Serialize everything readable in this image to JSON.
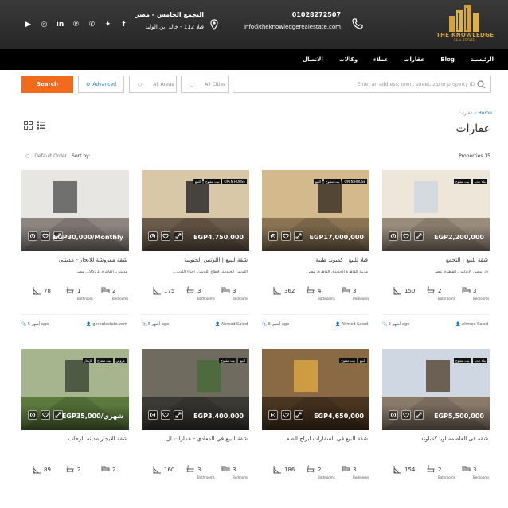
{
  "header": {
    "logo_text": "THE KNOWLEDGE",
    "logo_sub": "REAL ESTATE",
    "phone": "01028272507",
    "email": "info@theknowledgerealestate.com",
    "address_line1": "التجمع الخامس - مصر",
    "address_line2": "فيلا 112 - خالد ابن الوليد",
    "socials": [
      "facebook-icon",
      "twitter-icon",
      "whatsapp-icon",
      "pinterest-icon",
      "linkedin-icon",
      "instagram-icon",
      "youtube-icon"
    ]
  },
  "nav": {
    "items": [
      "الرئيسية",
      "Blog",
      "عقارات",
      "عملاء",
      "وكالات",
      "الاتصال"
    ]
  },
  "search": {
    "button": "Search",
    "advanced": "Advanced",
    "areas": "All Areas",
    "cities": "All Cities",
    "address_placeholder": "Enter an address, town, street, zip or property ID"
  },
  "breadcrumb": {
    "home": "Home",
    "current": "عقارات"
  },
  "page_title": "عقارات",
  "listing": {
    "count": "Properties 15",
    "sort_label": "Sort by:",
    "sort_value": "Default Order"
  },
  "cards": [
    {
      "tags": [],
      "price": "EGP30,000/Monthly",
      "title": "شقة مفروشة للايجار - مدينتي",
      "address": "مدينتي, القاهرة, 19511, مصر",
      "area": "78",
      "area_label": "",
      "baths": "1",
      "baths_label": "Bathroom",
      "beds": "2",
      "beds_label": "Bedrooms",
      "agent": "gerealestate.com",
      "time": "5 أشهر ago"
    },
    {
      "tags": [
        "للبيع",
        "بيت مفتوح",
        "OPEN HOUSE"
      ],
      "price": "EGP4,750,000",
      "title": "شقة للبيع | اللوتس الجنوبية",
      "address": "اللوتس الجنوبية, قطاع اللوتس, أحياء اللوت...",
      "area": "175",
      "area_label": "",
      "baths": "3",
      "baths_label": "Bathrooms",
      "beds": "3",
      "beds_label": "Bedrooms",
      "agent": "Ahmed Saied",
      "time": "5 أشهر ago"
    },
    {
      "tags": [
        "للبيع",
        "بيت مفتوح",
        "OPEN HOUSE"
      ],
      "price": "EGP17,000,000",
      "title": "فيلا للبيع | كمبوند طيبة",
      "address": "مدينة القاهرة الجديدة, القاهرة, مصر",
      "area": "362",
      "area_label": "",
      "baths": "4",
      "baths_label": "Bathrooms",
      "beds": "3",
      "beds_label": "Bedrooms",
      "agent": "Ahmed Saied",
      "time": "5 أشهر ago"
    },
    {
      "tags": [
        "بيت مفتوح",
        "بناء جديد"
      ],
      "price": "EGP2,200,000",
      "title": "شقة للبيع | التجمع",
      "address": "دار مصر, الأندلس, القاهرة, مصر",
      "area": "150",
      "area_label": "",
      "baths": "2",
      "baths_label": "Bathrooms",
      "beds": "3",
      "beds_label": "Bedrooms",
      "agent": "Ahmed Saied",
      "time": "5 أشهر ago"
    },
    {
      "tags": [
        "للإيجار",
        "بيت مفتوح",
        "عروض"
      ],
      "price": "EGP35,000/شهري",
      "title": "شقة للايجار مدينه الرحاب",
      "address": "",
      "area": "89",
      "area_label": "",
      "baths": "2",
      "baths_label": "",
      "beds": "2",
      "beds_label": "",
      "agent": "",
      "time": ""
    },
    {
      "tags": [
        "بيت مفتوح",
        "للبيع"
      ],
      "price": "EGP3,400,000",
      "title": "شقة للبيع في المعادي - عمارات ال...",
      "address": "",
      "area": "160",
      "area_label": "",
      "baths": "3",
      "baths_label": "Bathrooms",
      "beds": "3",
      "beds_label": "Bedrooms",
      "agent": "",
      "time": ""
    },
    {
      "tags": [
        "بيت مفتوح",
        "للبيع"
      ],
      "price": "EGP4,650,000",
      "title": "شقة للبيع في السفارات ابراج الصفـ...",
      "address": "",
      "area": "186",
      "area_label": "",
      "baths": "2",
      "baths_label": "Bathrooms",
      "beds": "3",
      "beds_label": "Bedrooms",
      "agent": "",
      "time": ""
    },
    {
      "tags": [
        "بيت مفتوح",
        "بناء جديد"
      ],
      "price": "EGP5,500,000",
      "title": "شقه فى العاصمه اويا كمباوند",
      "address": "",
      "area": "154",
      "area_label": "",
      "baths": "2",
      "baths_label": "Bathrooms",
      "beds": "3",
      "beds_label": "Bedrooms",
      "agent": "",
      "time": ""
    }
  ],
  "colors": {
    "accent": "#f26a1b",
    "gold": "#d4a235",
    "link": "#1a73c8"
  }
}
